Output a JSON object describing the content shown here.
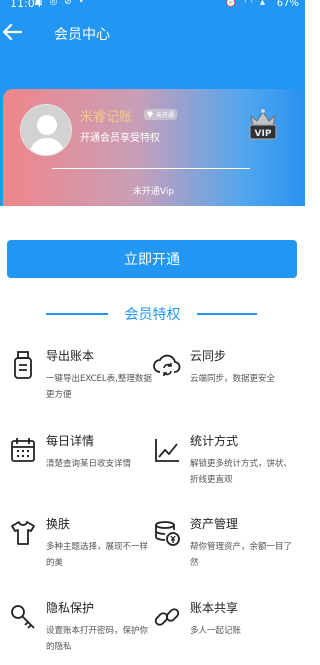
{
  "status_bar": {
    "time": "11:04",
    "battery": "67%"
  },
  "header": {
    "title": "会员中心"
  },
  "card": {
    "username": "米睿记账",
    "badge_label": "未开通",
    "description": "开通会员享受特权",
    "vip_status": "未开通Vip",
    "crown_text": "VIP"
  },
  "open_button": {
    "label": "立即开通"
  },
  "privileges": {
    "title": "会员特权",
    "items": [
      {
        "icon": "usb-export-icon",
        "title": "导出账本",
        "desc": "一键导出EXCEL表,整理数据更方便"
      },
      {
        "icon": "cloud-sync-icon",
        "title": "云同步",
        "desc": "云端同步，数据更安全"
      },
      {
        "icon": "calendar-icon",
        "title": "每日详情",
        "desc": "清楚查询某日收支详情"
      },
      {
        "icon": "chart-icon",
        "title": "统计方式",
        "desc": "解锁更多统计方式，饼状、折线更直观"
      },
      {
        "icon": "tshirt-icon",
        "title": "换肤",
        "desc": "多种主题选择，展现不一样的美"
      },
      {
        "icon": "coins-icon",
        "title": "资产管理",
        "desc": "帮你管理资产，余额一目了然"
      },
      {
        "icon": "key-icon",
        "title": "隐私保护",
        "desc": "设置账本打开密码，保护你的隐私"
      },
      {
        "icon": "link-icon",
        "title": "账本共享",
        "desc": "多人一起记账"
      }
    ]
  }
}
